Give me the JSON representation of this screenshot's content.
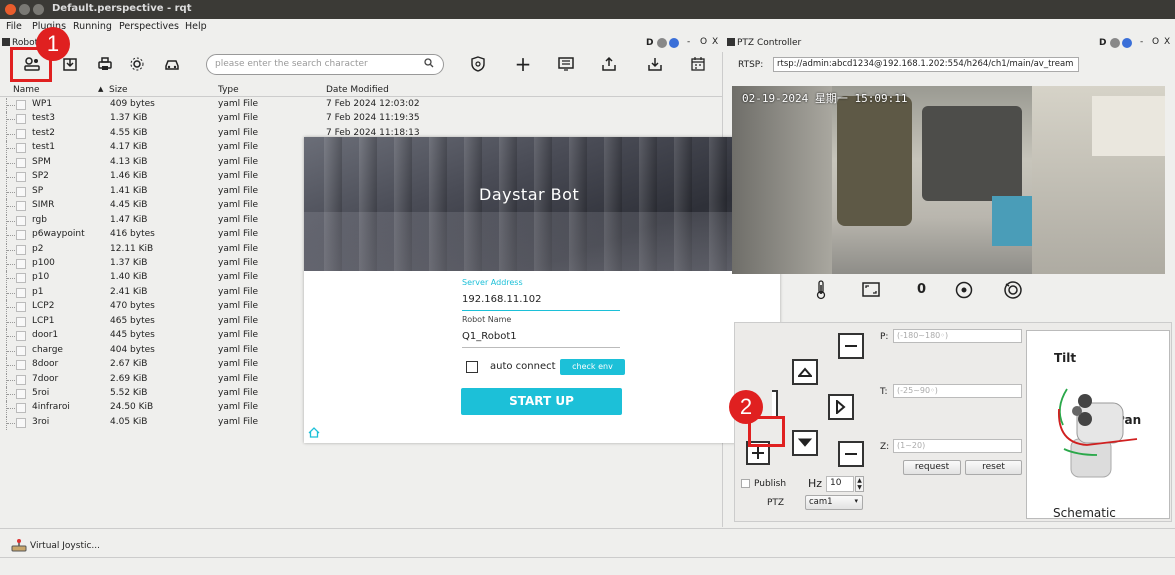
{
  "window": {
    "title": "Default.perspective - rqt"
  },
  "menu": {
    "file": "File",
    "plugins": "Plugins",
    "running": "Running",
    "perspectives": "Perspectives",
    "help": "Help"
  },
  "left_panel": {
    "title": "Robot",
    "controls": "D",
    "search_placeholder": "please enter the search character",
    "columns": {
      "name": "Name",
      "size": "Size",
      "type": "Type",
      "date": "Date Modified"
    },
    "rows": [
      {
        "name": "WP1",
        "size": "409 bytes",
        "type": "yaml File",
        "date": "7 Feb 2024 12:03:02"
      },
      {
        "name": "test3",
        "size": "1.37 KiB",
        "type": "yaml File",
        "date": "7 Feb 2024 11:19:35"
      },
      {
        "name": "test2",
        "size": "4.55 KiB",
        "type": "yaml File",
        "date": "7 Feb 2024 11:18:13"
      },
      {
        "name": "test1",
        "size": "4.17 KiB",
        "type": "yaml File",
        "date": ""
      },
      {
        "name": "SPM",
        "size": "4.13 KiB",
        "type": "yaml File",
        "date": ""
      },
      {
        "name": "SP2",
        "size": "1.46 KiB",
        "type": "yaml File",
        "date": ""
      },
      {
        "name": "SP",
        "size": "1.41 KiB",
        "type": "yaml File",
        "date": ""
      },
      {
        "name": "SIMR",
        "size": "4.45 KiB",
        "type": "yaml File",
        "date": ""
      },
      {
        "name": "rgb",
        "size": "1.47 KiB",
        "type": "yaml File",
        "date": ""
      },
      {
        "name": "p6waypoint",
        "size": "416 bytes",
        "type": "yaml File",
        "date": ""
      },
      {
        "name": "p2",
        "size": "12.11 KiB",
        "type": "yaml File",
        "date": ""
      },
      {
        "name": "p100",
        "size": "1.37 KiB",
        "type": "yaml File",
        "date": ""
      },
      {
        "name": "p10",
        "size": "1.40 KiB",
        "type": "yaml File",
        "date": ""
      },
      {
        "name": "p1",
        "size": "2.41 KiB",
        "type": "yaml File",
        "date": ""
      },
      {
        "name": "LCP2",
        "size": "470 bytes",
        "type": "yaml File",
        "date": ""
      },
      {
        "name": "LCP1",
        "size": "465 bytes",
        "type": "yaml File",
        "date": ""
      },
      {
        "name": "door1",
        "size": "445 bytes",
        "type": "yaml File",
        "date": ""
      },
      {
        "name": "charge",
        "size": "404 bytes",
        "type": "yaml File",
        "date": ""
      },
      {
        "name": "8door",
        "size": "2.67 KiB",
        "type": "yaml File",
        "date": ""
      },
      {
        "name": "7door",
        "size": "2.69 KiB",
        "type": "yaml File",
        "date": ""
      },
      {
        "name": "5roi",
        "size": "5.52 KiB",
        "type": "yaml File",
        "date": ""
      },
      {
        "name": "4infraroi",
        "size": "24.50 KiB",
        "type": "yaml File",
        "date": ""
      },
      {
        "name": "3roi",
        "size": "4.05 KiB",
        "type": "yaml File",
        "date": ""
      }
    ]
  },
  "dialog": {
    "banner_title": "Daystar Bot",
    "server_label": "Server Address",
    "server_value": "192.168.11.102",
    "robot_label": "Robot Name",
    "robot_value": "Q1_Robot1",
    "auto_connect": "auto connect",
    "check_env": "check env",
    "start_up": "START UP"
  },
  "ptz": {
    "title": "PTZ Controller",
    "controls": "D",
    "rtsp_label": "RTSP:",
    "rtsp_value": "rtsp://admin:abcd1234@192.168.1.202:554/h264/ch1/main/av_tream",
    "video_timestamp": "02-19-2024 星期一 15:09:11",
    "zoom_value": "0",
    "p_label": "P:",
    "p_placeholder": "(-180~180◦)",
    "t_label": "T:",
    "t_placeholder": "(-25~90◦)",
    "z_label": "Z:",
    "z_placeholder": "(1~20)",
    "request": "request",
    "reset": "reset",
    "publish": "Publish",
    "hz_label": "Hz",
    "hz_value": "10",
    "ptz_label": "PTZ",
    "ptz_select": "cam1",
    "schematic_title": "Schematic",
    "tilt": "Tilt",
    "pan": "Pan"
  },
  "bottom": {
    "joystick": "Virtual Joystic..."
  },
  "annotations": {
    "badge1": "1",
    "badge2": "2"
  },
  "colors": {
    "accent": "#1cc0d8",
    "highlight": "#e02020",
    "titlebar": "#3b3a36"
  }
}
